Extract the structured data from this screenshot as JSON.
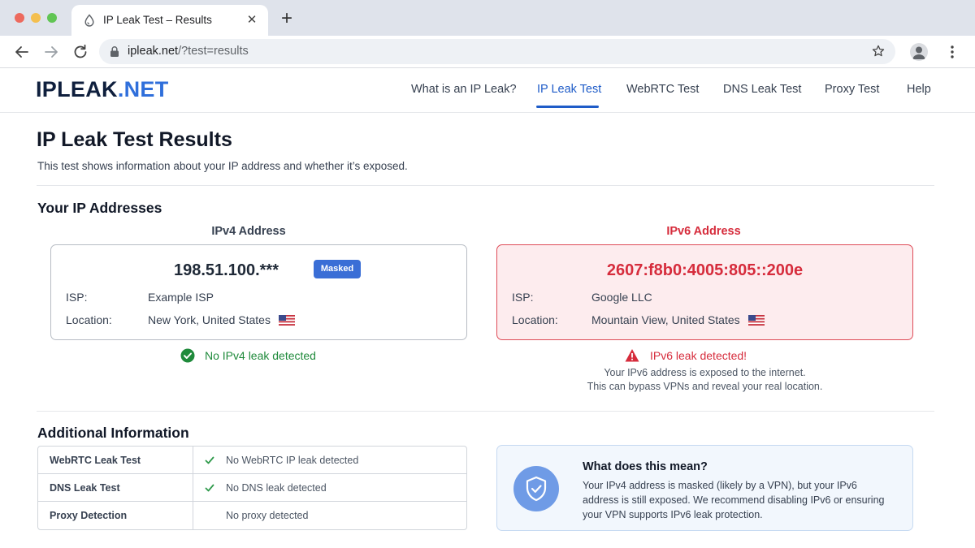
{
  "browser": {
    "tab_title": "IP Leak Test – Results",
    "url_host": "ipleak.net",
    "url_path": "/?test=results"
  },
  "site": {
    "logo_primary": "IPLEAK",
    "logo_secondary": ".NET",
    "nav": [
      {
        "label": "What is an IP Leak?"
      },
      {
        "label": "IP Leak Test",
        "active": true
      },
      {
        "label": "WebRTC Test"
      },
      {
        "label": "DNS Leak Test"
      },
      {
        "label": "Proxy Test"
      },
      {
        "label": "Help"
      }
    ]
  },
  "page": {
    "title": "IP Leak Test Results",
    "subtitle": "This test shows information about your IP address and whether it’s exposed."
  },
  "ip_section": {
    "title": "Your IP Addresses",
    "ipv4": {
      "heading": "IPv4 Address",
      "address": "198.51.100.***",
      "badge": "Masked",
      "isp_label": "ISP:",
      "isp": "Example ISP",
      "location_label": "Location:",
      "location": "New York, United States",
      "status": "No IPv4 leak detected"
    },
    "ipv6": {
      "heading": "IPv6 Address",
      "address": "2607:f8b0:4005:805::200e",
      "isp_label": "ISP:",
      "isp": "Google LLC",
      "location_label": "Location:",
      "location": "Mountain View, United States",
      "status": "IPv6 leak detected!",
      "explain_1": "Your IPv6 address is exposed to the internet.",
      "explain_2": "This can bypass VPNs and reveal your real location."
    }
  },
  "additional": {
    "title": "Additional Information",
    "rows": [
      {
        "key": "WebRTC Leak Test",
        "value": "No WebRTC IP leak detected",
        "check": true
      },
      {
        "key": "DNS Leak Test",
        "value": "No DNS leak detected",
        "check": true
      },
      {
        "key": "Proxy Detection",
        "value": "No proxy detected",
        "check": false
      }
    ],
    "meaning_title": "What does this mean?",
    "meaning_body": "Your IPv4 address is masked (likely by a VPN), but your IPv6 address is still exposed. We recommend disabling IPv6 or ensuring your VPN supports IPv6 leak protection."
  },
  "colors": {
    "accent": "#1f5cc8",
    "ok": "#1f8a3b",
    "danger": "#d62c3c"
  }
}
